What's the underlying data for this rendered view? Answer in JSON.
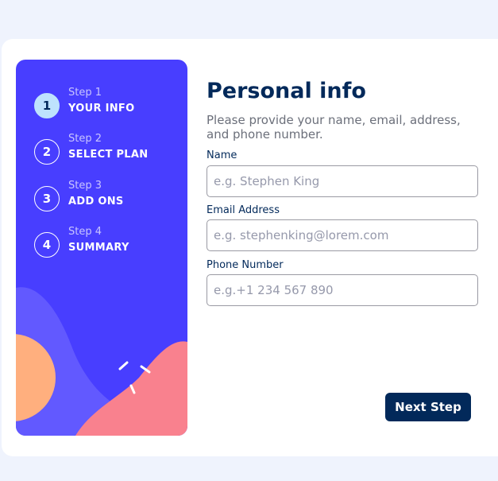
{
  "sidebar": {
    "steps": [
      {
        "number": "1",
        "caption": "Step 1",
        "title": "YOUR INFO",
        "active": true
      },
      {
        "number": "2",
        "caption": "Step 2",
        "title": "SELECT PLAN",
        "active": false
      },
      {
        "number": "3",
        "caption": "Step 3",
        "title": "ADD ONS",
        "active": false
      },
      {
        "number": "4",
        "caption": "Step 4",
        "title": "SUMMARY",
        "active": false
      }
    ],
    "colors": {
      "background": "#483eff",
      "active_step": "#bee2fd",
      "blob_purple": "#6259ff",
      "blob_orange": "#ffaf7e",
      "blob_pink": "#f9818e"
    }
  },
  "main": {
    "title": "Personal info",
    "subtitle": "Please provide your name, email, address, and phone number.",
    "fields": [
      {
        "label": "Name",
        "placeholder": "e.g. Stephen King",
        "value": ""
      },
      {
        "label": "Email Address",
        "placeholder": "e.g. stephenking@lorem.com",
        "value": ""
      },
      {
        "label": "Phone Number",
        "placeholder": "e.g.+1 234 567 890",
        "value": ""
      }
    ],
    "next_button_label": "Next Step"
  },
  "colors": {
    "page_background": "#eff3fd",
    "card_background": "#ffffff",
    "primary_text": "#02295a",
    "secondary_text": "#6b6f7a",
    "button_background": "#02295a"
  }
}
